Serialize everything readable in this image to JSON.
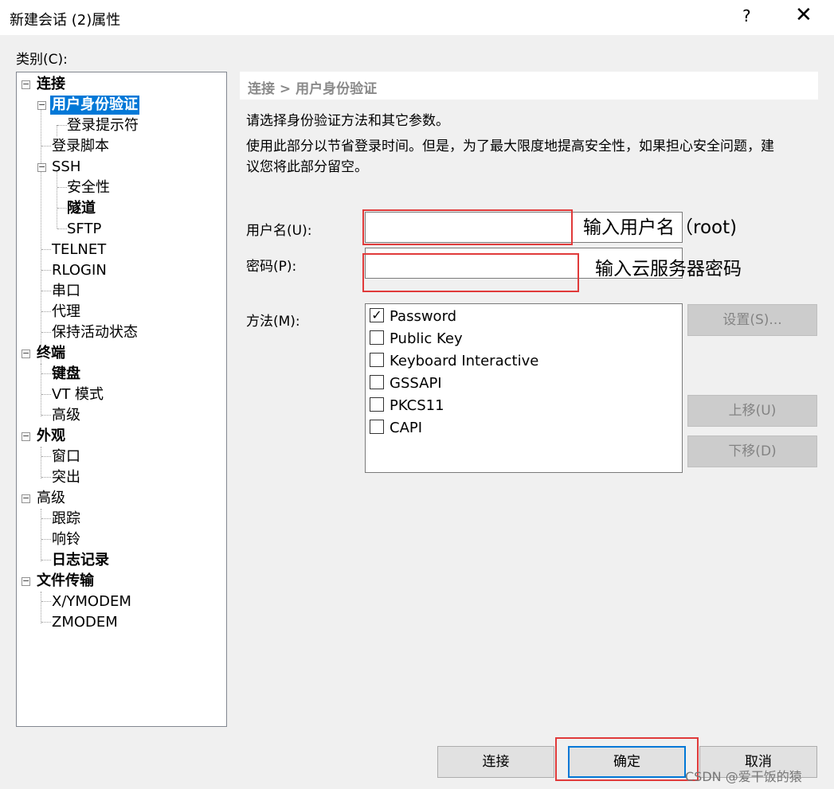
{
  "window": {
    "title": "新建会话 (2)属性",
    "help": "?",
    "close": "✕"
  },
  "category_label": "类别(C):",
  "tree": {
    "connection": "连接",
    "user_auth": "用户身份验证",
    "login_prompt": "登录提示符",
    "login_script": "登录脚本",
    "ssh": "SSH",
    "security": "安全性",
    "tunnel": "隧道",
    "sftp": "SFTP",
    "telnet": "TELNET",
    "rlogin": "RLOGIN",
    "serial": "串口",
    "proxy": "代理",
    "keepalive": "保持活动状态",
    "terminal": "终端",
    "keyboard": "键盘",
    "vt_mode": "VT 模式",
    "advanced_term": "高级",
    "appearance": "外观",
    "window": "窗口",
    "highlight": "突出",
    "advanced": "高级",
    "trace": "跟踪",
    "bell": "响铃",
    "logging": "日志记录",
    "file_transfer": "文件传输",
    "xymodem": "X/YMODEM",
    "zmodem": "ZMODEM"
  },
  "breadcrumb": "连接 > 用户身份验证",
  "desc1": "请选择身份验证方法和其它参数。",
  "desc2a": "使用此部分以节省登录时间。但是，为了最大限度地提高安全性，如果担心安全问题，建",
  "desc2b": "议您将此部分留空。",
  "username_label": "用户名(U):",
  "password_label": "密码(P):",
  "method_label": "方法(M):",
  "annotations": {
    "username": "输入用户名（root)",
    "password": "输入云服务器密码"
  },
  "methods": [
    {
      "label": "Password",
      "checked": "✓"
    },
    {
      "label": "Public Key",
      "checked": ""
    },
    {
      "label": "Keyboard Interactive",
      "checked": ""
    },
    {
      "label": "GSSAPI",
      "checked": ""
    },
    {
      "label": "PKCS11",
      "checked": ""
    },
    {
      "label": "CAPI",
      "checked": ""
    }
  ],
  "buttons": {
    "settings": "设置(S)...",
    "move_up": "上移(U)",
    "move_down": "下移(D)",
    "connect": "连接",
    "ok": "确定",
    "cancel": "取消"
  },
  "watermark": "CSDN @爱干饭的猿"
}
